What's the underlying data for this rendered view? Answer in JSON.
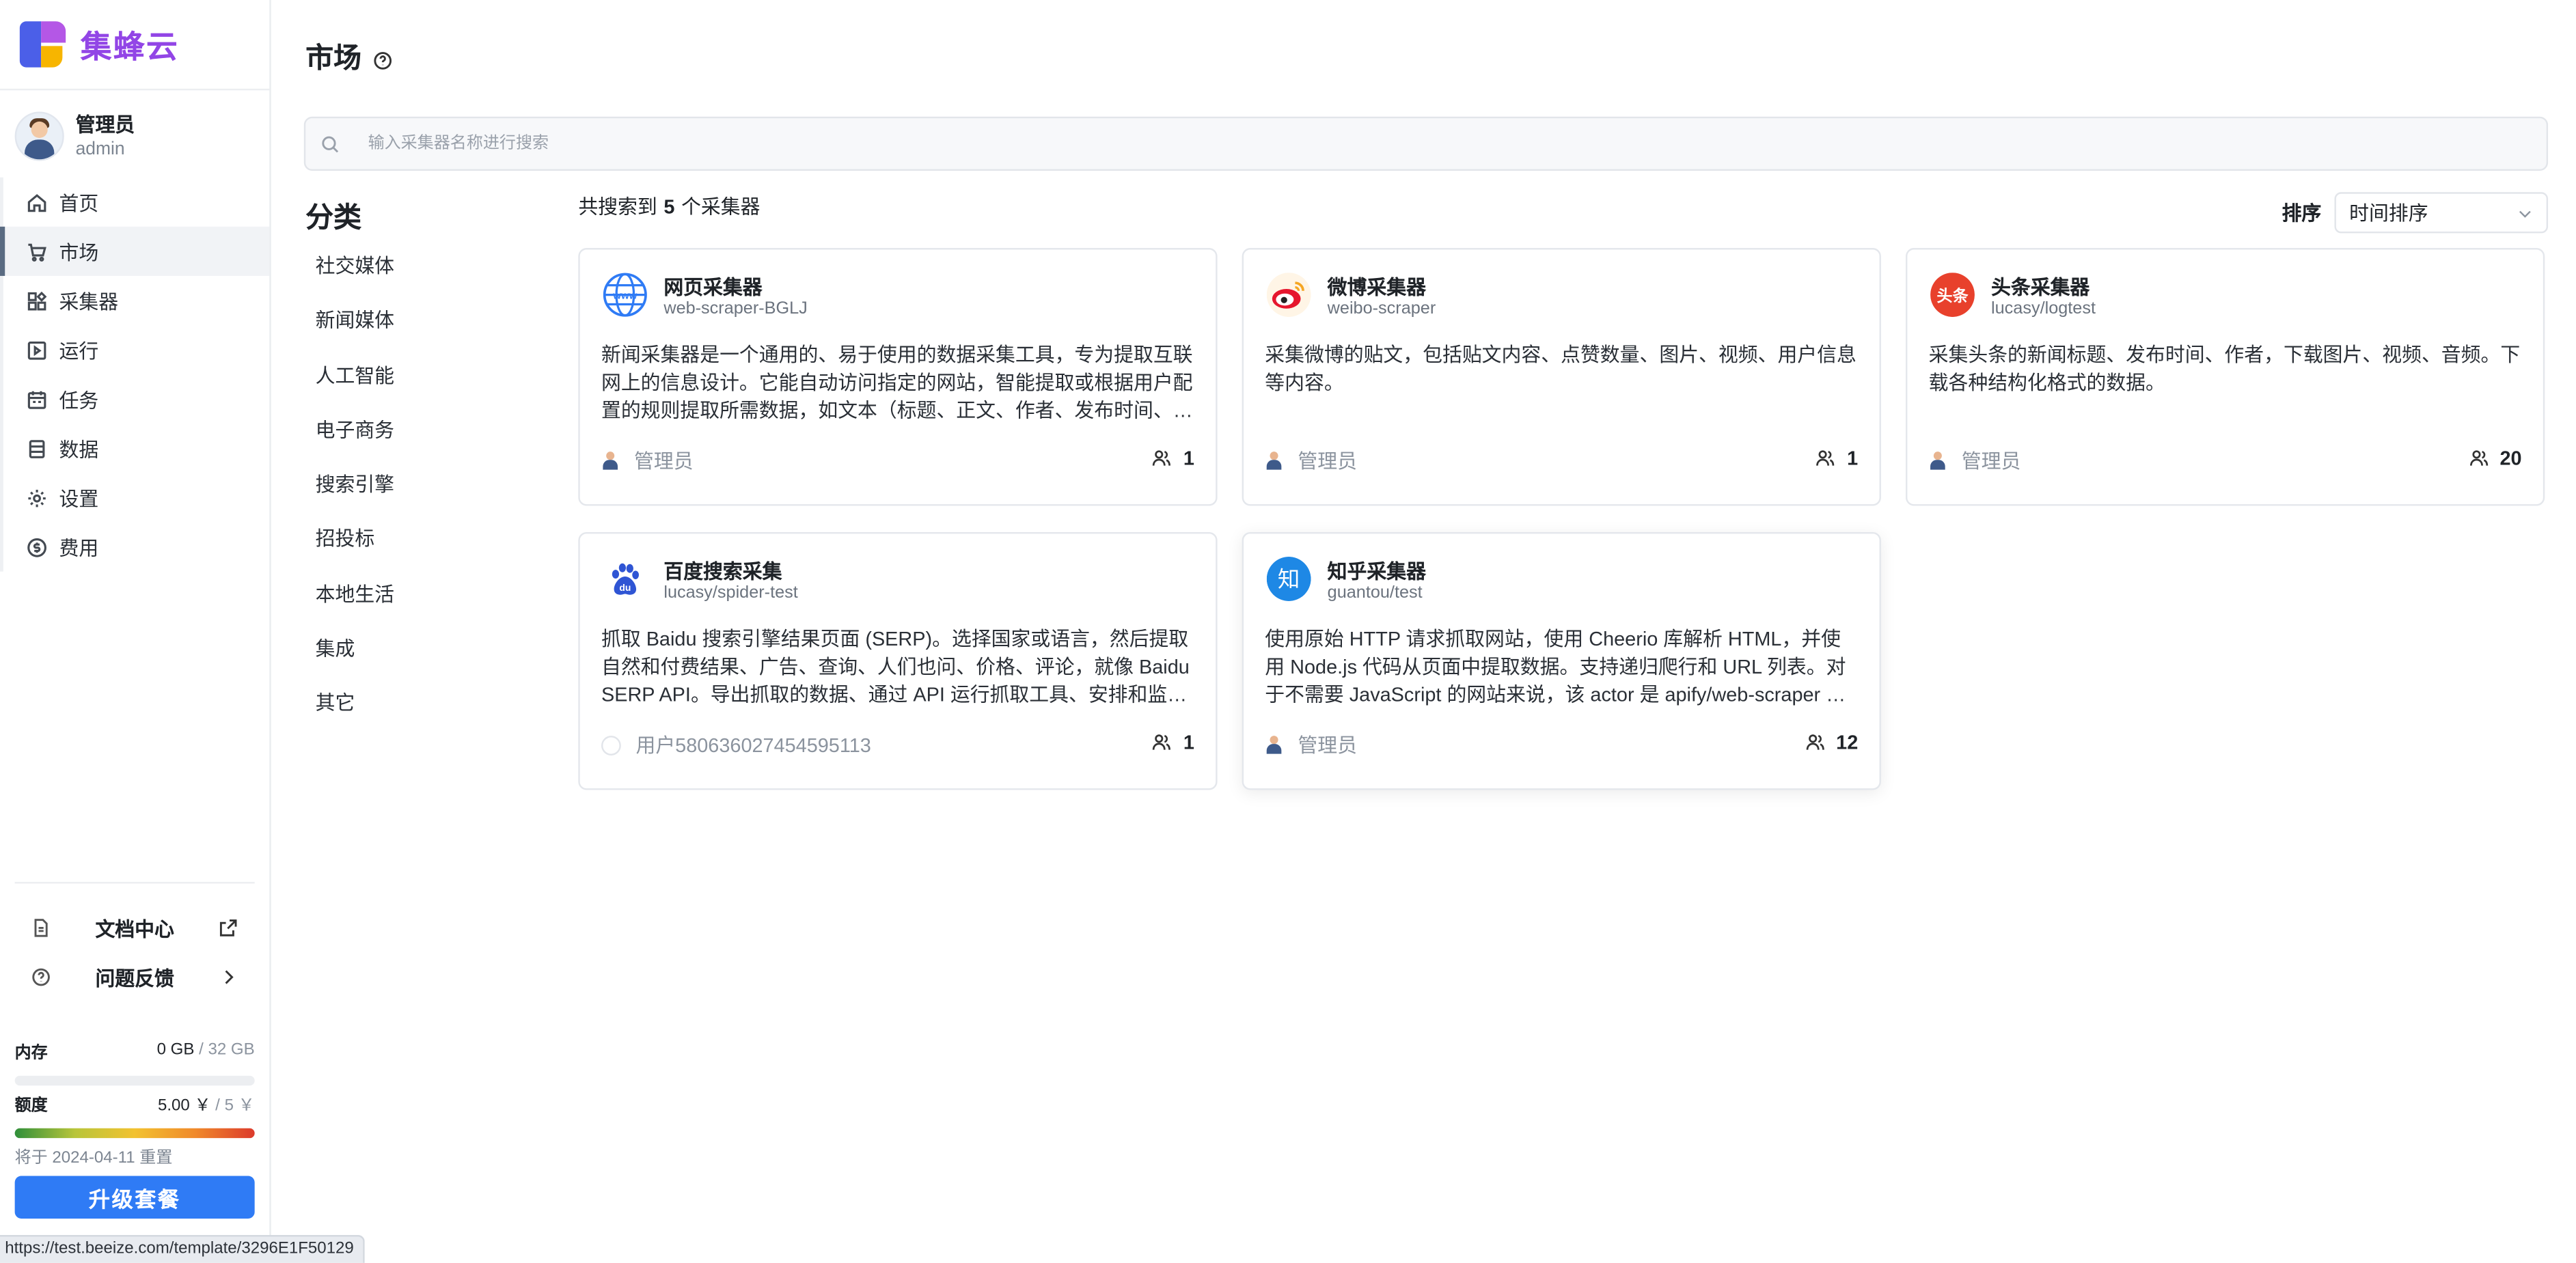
{
  "brand": {
    "name": "集蜂云"
  },
  "user": {
    "name": "管理员",
    "id": "admin"
  },
  "nav": [
    {
      "label": "首页",
      "icon": "home-icon"
    },
    {
      "label": "市场",
      "icon": "cart-icon",
      "active": true
    },
    {
      "label": "采集器",
      "icon": "widgets-icon"
    },
    {
      "label": "运行",
      "icon": "play-square-icon"
    },
    {
      "label": "任务",
      "icon": "calendar-icon"
    },
    {
      "label": "数据",
      "icon": "database-icon"
    },
    {
      "label": "设置",
      "icon": "gear-icon"
    },
    {
      "label": "费用",
      "icon": "dollar-circle-icon"
    }
  ],
  "bottom_links": {
    "docs": "文档中心",
    "feedback": "问题反馈"
  },
  "usage": {
    "memory": {
      "label": "内存",
      "used": "0 GB",
      "total": "32 GB",
      "fraction": 0.0
    },
    "quota": {
      "label": "额度",
      "used": "5.00 ￥",
      "total": "5 ￥",
      "fraction": 1.0
    },
    "reset_text": "将于 2024-04-11 重置"
  },
  "upgrade_label": "升级套餐",
  "status_url": "https://test.beeize.com/template/3296E1F50129",
  "page": {
    "title": "市场"
  },
  "search": {
    "placeholder": "输入采集器名称进行搜索",
    "value": ""
  },
  "categories": {
    "title": "分类",
    "items": [
      "社交媒体",
      "新闻媒体",
      "人工智能",
      "电子商务",
      "搜索引擎",
      "招投标",
      "本地生活",
      "集成",
      "其它"
    ]
  },
  "results": {
    "prefix": "共搜索到",
    "count": "5",
    "suffix": "个采集器"
  },
  "sort": {
    "label": "排序",
    "value": "时间排序"
  },
  "cards": [
    {
      "title": "网页采集器",
      "slug": "web-scraper-BGLJ",
      "icon": "globe-icon",
      "description": "新闻采集器是一个通用的、易于使用的数据采集工具，专为提取互联网上的信息设计。它能自动访问指定的网站，智能提取或根据用户配置的规则提取所需数据，如文本（标题、正文、作者、发布时间、关键词等）",
      "author": "管理员",
      "runs": "1"
    },
    {
      "title": "微博采集器",
      "slug": "weibo-scraper",
      "icon": "weibo-icon",
      "description": "采集微博的贴文，包括贴文内容、点赞数量、图片、视频、用户信息等内容。",
      "author": "管理员",
      "runs": "1"
    },
    {
      "title": "头条采集器",
      "slug": "lucasy/logtest",
      "icon": "toutiao-icon",
      "icon_text": "头条",
      "description": "采集头条的新闻标题、发布时间、作者，下载图片、视频、音频。下载各种结构化格式的数据。",
      "author": "管理员",
      "runs": "20"
    },
    {
      "title": "百度搜索采集",
      "slug": "lucasy/spider-test",
      "icon": "baidu-icon",
      "description": "抓取 Baidu 搜索引擎结果页面 (SERP)。选择国家或语言，然后提取自然和付费结果、广告、查询、人们也问、价格、评论，就像 Baidu SERP API。导出抓取的数据、通过 API 运行抓取工具、安排和监控运行",
      "author": "用户580636027454595113",
      "runs": "1"
    },
    {
      "title": "知乎采集器",
      "slug": "guantou/test",
      "icon": "zhihu-icon",
      "icon_text": "知",
      "description": "使用原始 HTTP 请求抓取网站，使用 Cheerio 库解析 HTML，并使用 Node.js 代码从页面中提取数据。支持递归爬行和 URL 列表。对于不需要 JavaScript 的网站来说，该 actor 是 apify/web-scraper 的高性能替代品。",
      "author": "管理员",
      "runs": "12"
    }
  ],
  "colors": {
    "brand": "#9245e6",
    "primary": "#2f7bf5",
    "toutiao": "#e8412c",
    "zhihu": "#1e88e5",
    "baidu": "#2f55d4",
    "weibo": "#e6162d"
  }
}
